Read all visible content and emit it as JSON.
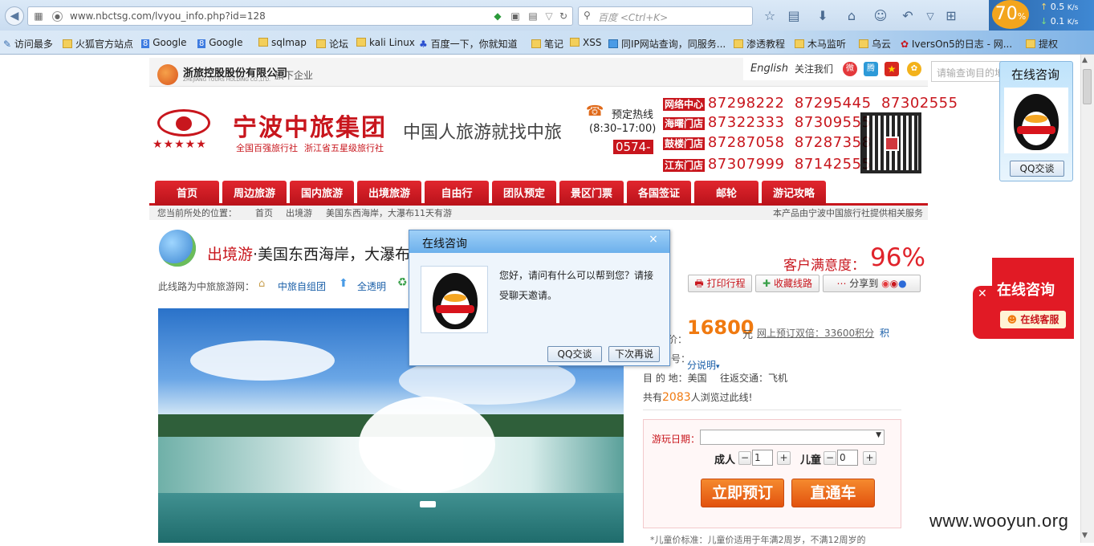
{
  "browser": {
    "url": "www.nbctsg.com/lvyou_info.php?id=128",
    "search_placeholder": "百度 <Ctrl+K>",
    "progress_label": "70",
    "progress_unit": "%",
    "speed_up": "0.5",
    "speed_down": "0.1",
    "speed_unit": "K/s",
    "bookmarks": [
      "访问最多",
      "火狐官方站点",
      "Google",
      "Google",
      "sqlmap",
      "论坛",
      "kali Linux",
      "百度一下，你就知道",
      "笔记",
      "XSS",
      "同IP网站查询，同服务...",
      "渗透教程",
      "木马监听",
      "乌云",
      "IversOn5的日志 - 网...",
      "提权"
    ]
  },
  "header": {
    "parent_company": "浙旅控股股份有限公司",
    "parent_company_en": "ZHEJIANG TOURS HOLDING CO.,LTD.",
    "subsidiary_label": "旗下企业",
    "lang_link": "English",
    "follow_label": "关注我们",
    "search_placeholder": "请输查询目的地",
    "brand_name": "宁波中旅集团",
    "brand_tag1": "全国百强旅行社",
    "brand_tag2": "浙江省五星级旅行社",
    "stars": "★★★★★",
    "slogan": "中国人旅游就找中旅",
    "hotline_label": "预定热线",
    "hotline_hours": "(8:30–17:00)",
    "area_code": "0574-",
    "branches": [
      {
        "name": "网络中心",
        "phones": "87298222  87295445  87302555"
      },
      {
        "name": "海曙门店",
        "phones": "87322333  87309555"
      },
      {
        "name": "鼓楼门店",
        "phones": "87287058  87287358"
      },
      {
        "name": "江东门店",
        "phones": "87307999  87142555"
      }
    ]
  },
  "nav": [
    "首页",
    "周边旅游",
    "国内旅游",
    "出境旅游",
    "自由行",
    "团队预定",
    "景区门票",
    "各国签证",
    "邮轮",
    "游记攻略"
  ],
  "breadcrumb": {
    "prefix": "您当前所处的位置：",
    "items": [
      "首页",
      "出境游",
      "美国东西海岸，大瀑布11天有游"
    ],
    "note": "本产品由宁波中国旅行社提供相关服务"
  },
  "product": {
    "category": "出境游",
    "title": "·美国东西海岸，大瀑布",
    "satisfaction_label": "客户满意度：",
    "satisfaction_value": "96%",
    "route_label": "此线路为中旅旅游网：",
    "tag1": "中旅自组团",
    "tag2": "全透明",
    "print_label": "打印行程",
    "fav_label": "收藏线路",
    "share_label": "分享到",
    "price_prefix": "价：",
    "price": "16800",
    "price_unit": "元",
    "points_text": "网上预订双倍：33600积分",
    "points_tail": "积",
    "code_label": "号：",
    "code_tail": "分说明",
    "destination": "目 的 地：美国",
    "transport": "往返交通：飞机",
    "views_prefix": "共有",
    "views": "2083",
    "views_suffix": "人浏览过此线!",
    "date_label": "游玩日期：",
    "adult_label": "成人",
    "adult_value": "1",
    "child_label": "儿童",
    "child_value": "0",
    "book_label": "立即预订",
    "bus_label": "直通车",
    "child_note": "*儿童价标准：儿童价适用于年满2周岁，不满12周岁的"
  },
  "qq_dialog": {
    "title": "在线咨询",
    "close": "×",
    "message": "您好，请问有什么可以帮到您？请接受聊天邀请。",
    "accept": "QQ交谈",
    "later": "下次再说"
  },
  "side_qq": {
    "title": "在线咨询",
    "button": "QQ交谈"
  },
  "red_widget": {
    "title": "在线咨询",
    "button": "在线客服"
  },
  "watermark": "www.wooyun.org",
  "colors": {
    "brand_red": "#c8161d",
    "price_orange": "#f07a10",
    "qq_blue": "#6cb0ec"
  }
}
